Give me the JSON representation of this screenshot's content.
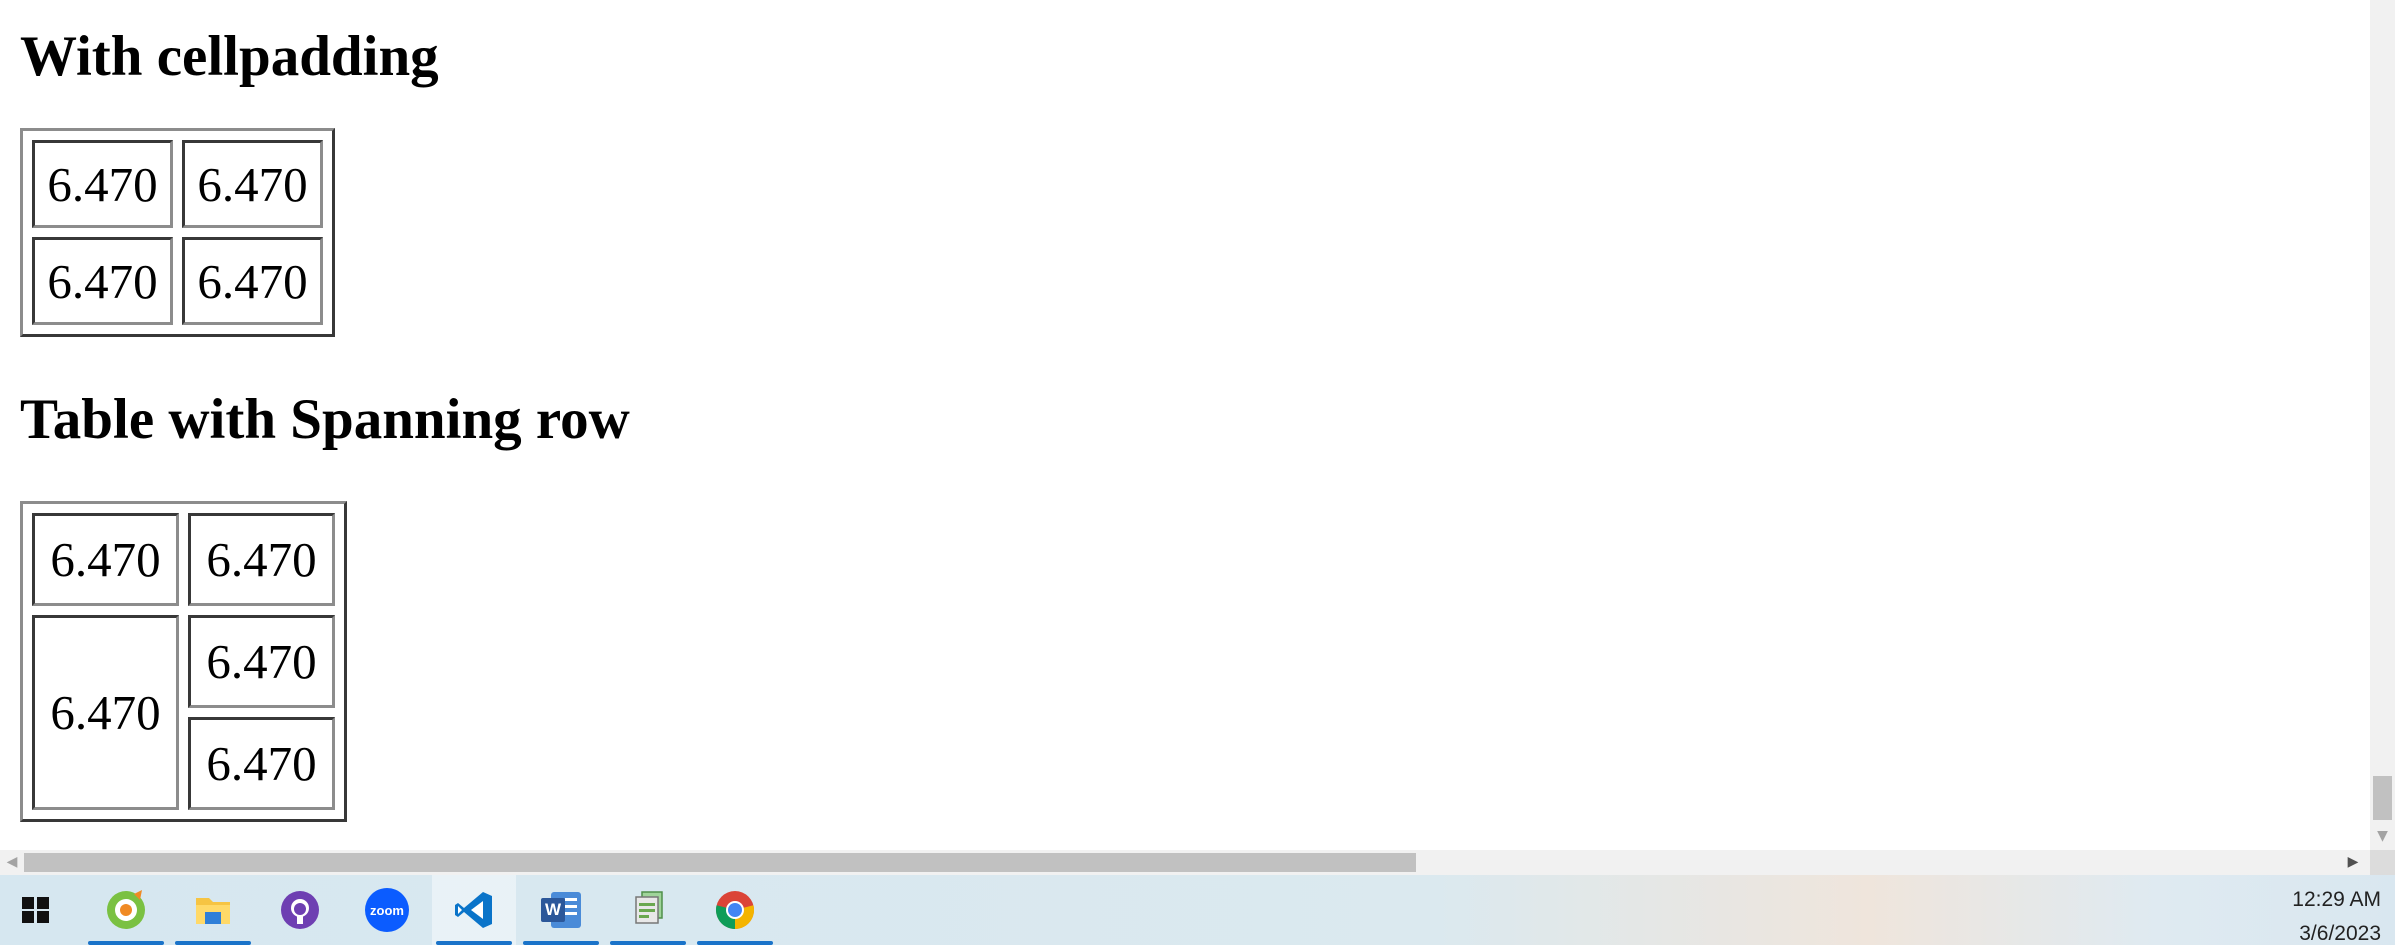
{
  "page": {
    "heading1": "With cellpadding",
    "table1": [
      [
        "6.470",
        "6.470"
      ],
      [
        "6.470",
        "6.470"
      ]
    ],
    "heading2": "Table with Spanning row",
    "table2": {
      "row1": [
        "6.470",
        "6.470"
      ],
      "spanning_cell": "6.470",
      "row2_right": "6.470",
      "row3_right": "6.470"
    }
  },
  "scrollbars": {
    "left_arrow": "◀",
    "right_arrow": "▶",
    "down_arrow": "▼"
  },
  "taskbar": {
    "apps": [
      {
        "name": "start-menu-icon"
      },
      {
        "name": "qq-browser-icon"
      },
      {
        "name": "file-explorer-icon"
      },
      {
        "name": "github-desktop-icon"
      },
      {
        "name": "zoom-icon",
        "label": "zoom"
      },
      {
        "name": "vscode-icon"
      },
      {
        "name": "word-icon",
        "label": "W"
      },
      {
        "name": "presentation-app-icon"
      },
      {
        "name": "chrome-icon"
      }
    ],
    "time": "12:29 AM",
    "date": "3/6/2023"
  },
  "colors": {
    "accent_indicator": "#1a73c9",
    "zoom_blue": "#0b5cff",
    "vscode_blue": "#0a74c9",
    "word_blue": "#2b579a",
    "github_purple": "#6e3fb2"
  }
}
